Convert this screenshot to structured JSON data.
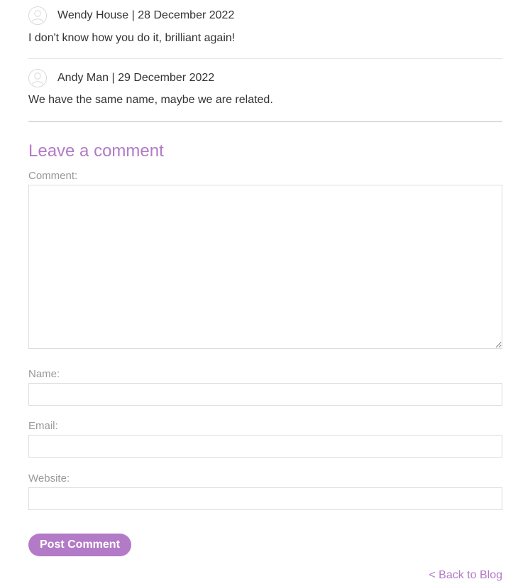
{
  "comments": [
    {
      "author_line": "Wendy House | 28 December 2022",
      "body": "I don't know how you do it, brilliant again!"
    },
    {
      "author_line": "Andy Man | 29 December 2022",
      "body": "We have the same name, maybe we are related."
    }
  ],
  "form": {
    "title": "Leave a comment",
    "comment_label": "Comment:",
    "comment_value": "",
    "name_label": "Name:",
    "name_value": "",
    "email_label": "Email:",
    "email_value": "",
    "website_label": "Website:",
    "website_value": "",
    "submit_label": "Post Comment"
  },
  "nav": {
    "back_label": "< Back to Blog"
  },
  "colors": {
    "accent": "#b37ac7",
    "text": "#333333",
    "label": "#999999",
    "border": "#dcdcdc"
  },
  "icons": {
    "avatar": "user-avatar-icon"
  }
}
